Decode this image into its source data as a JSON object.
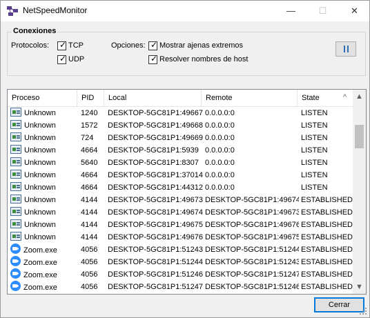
{
  "window": {
    "title": "NetSpeedMonitor",
    "minimize": "—",
    "maximize": "☐",
    "close": "✕"
  },
  "group": {
    "title": "Conexiones",
    "protocols_label": "Protocolos:",
    "tcp": {
      "label": "TCP",
      "checked": true
    },
    "udp": {
      "label": "UDP",
      "checked": true
    },
    "options_label": "Opciones:",
    "show_remote": {
      "label": "Mostrar ajenas extremos",
      "checked": true
    },
    "resolve_hosts": {
      "label": "Resolver nombres de host",
      "checked": true
    },
    "check_glyph": "✓"
  },
  "table": {
    "columns": [
      "Proceso",
      "PID",
      "Local",
      "Remote",
      "State"
    ],
    "sort_glyph": "^",
    "rows": [
      {
        "icon": "unknown",
        "proc": "Unknown",
        "pid": "1240",
        "local": "DESKTOP-5GC81P1:49667",
        "remote": "0.0.0.0:0",
        "state": "LISTEN"
      },
      {
        "icon": "unknown",
        "proc": "Unknown",
        "pid": "1572",
        "local": "DESKTOP-5GC81P1:49668",
        "remote": "0.0.0.0:0",
        "state": "LISTEN"
      },
      {
        "icon": "unknown",
        "proc": "Unknown",
        "pid": "724",
        "local": "DESKTOP-5GC81P1:49669",
        "remote": "0.0.0.0:0",
        "state": "LISTEN"
      },
      {
        "icon": "unknown",
        "proc": "Unknown",
        "pid": "4664",
        "local": "DESKTOP-5GC81P1:5939",
        "remote": "0.0.0.0:0",
        "state": "LISTEN"
      },
      {
        "icon": "unknown",
        "proc": "Unknown",
        "pid": "5640",
        "local": "DESKTOP-5GC81P1:8307",
        "remote": "0.0.0.0:0",
        "state": "LISTEN"
      },
      {
        "icon": "unknown",
        "proc": "Unknown",
        "pid": "4664",
        "local": "DESKTOP-5GC81P1:37014",
        "remote": "0.0.0.0:0",
        "state": "LISTEN"
      },
      {
        "icon": "unknown",
        "proc": "Unknown",
        "pid": "4664",
        "local": "DESKTOP-5GC81P1:44312",
        "remote": "0.0.0.0:0",
        "state": "LISTEN"
      },
      {
        "icon": "unknown",
        "proc": "Unknown",
        "pid": "4144",
        "local": "DESKTOP-5GC81P1:49673",
        "remote": "DESKTOP-5GC81P1:49674",
        "state": "ESTABLISHED"
      },
      {
        "icon": "unknown",
        "proc": "Unknown",
        "pid": "4144",
        "local": "DESKTOP-5GC81P1:49674",
        "remote": "DESKTOP-5GC81P1:49673",
        "state": "ESTABLISHED"
      },
      {
        "icon": "unknown",
        "proc": "Unknown",
        "pid": "4144",
        "local": "DESKTOP-5GC81P1:49675",
        "remote": "DESKTOP-5GC81P1:49676",
        "state": "ESTABLISHED"
      },
      {
        "icon": "unknown",
        "proc": "Unknown",
        "pid": "4144",
        "local": "DESKTOP-5GC81P1:49676",
        "remote": "DESKTOP-5GC81P1:49675",
        "state": "ESTABLISHED"
      },
      {
        "icon": "zoom",
        "proc": "Zoom.exe",
        "pid": "4056",
        "local": "DESKTOP-5GC81P1:51243",
        "remote": "DESKTOP-5GC81P1:51244",
        "state": "ESTABLISHED"
      },
      {
        "icon": "zoom",
        "proc": "Zoom.exe",
        "pid": "4056",
        "local": "DESKTOP-5GC81P1:51244",
        "remote": "DESKTOP-5GC81P1:51243",
        "state": "ESTABLISHED"
      },
      {
        "icon": "zoom",
        "proc": "Zoom.exe",
        "pid": "4056",
        "local": "DESKTOP-5GC81P1:51246",
        "remote": "DESKTOP-5GC81P1:51247",
        "state": "ESTABLISHED"
      },
      {
        "icon": "zoom",
        "proc": "Zoom.exe",
        "pid": "4056",
        "local": "DESKTOP-5GC81P1:51247",
        "remote": "DESKTOP-5GC81P1:51246",
        "state": "ESTABLISHED"
      }
    ]
  },
  "scrollbar": {
    "up": "▲",
    "down": "▼"
  },
  "footer": {
    "close_label": "Cerrar"
  }
}
